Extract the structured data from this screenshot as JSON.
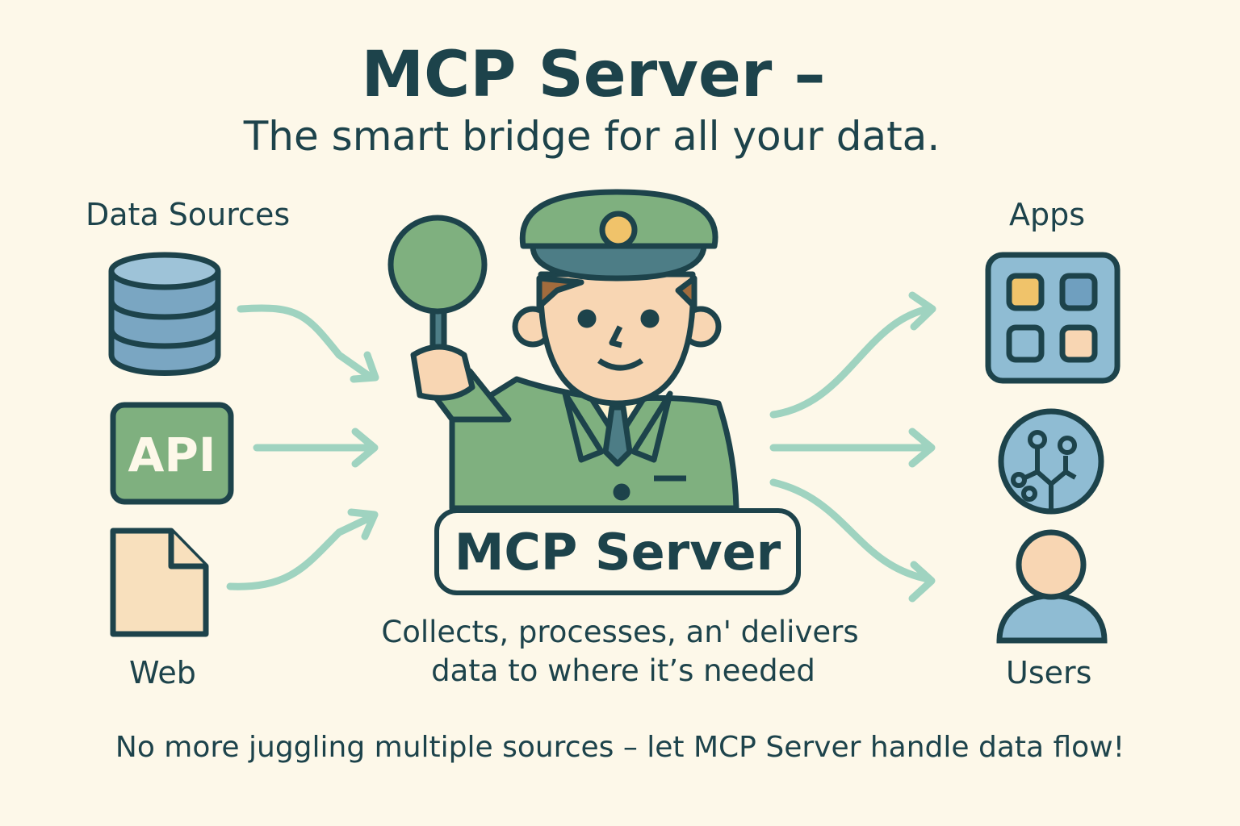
{
  "title": "MCP Server –",
  "subtitle": "The smart bridge for all your data.",
  "left": {
    "heading": "Data Sources",
    "items": [
      {
        "icon": "database-icon"
      },
      {
        "icon": "api-icon",
        "label": "API"
      },
      {
        "icon": "document-icon",
        "label": "Web"
      }
    ]
  },
  "right": {
    "heading": "Apps",
    "items": [
      {
        "icon": "apps-grid-icon"
      },
      {
        "icon": "circuit-icon"
      },
      {
        "icon": "user-icon",
        "label": "Users"
      }
    ]
  },
  "center": {
    "box_label": "MCP Server",
    "description_line1": "Collects, processes, an' delivers",
    "description_line2": "data to where it’s needed"
  },
  "footer": "No more juggling multiple sources – let MCP Server handle data flow!",
  "colors": {
    "background": "#fdf8e9",
    "ink": "#1d434b",
    "green": "#7fb07f",
    "blue": "#7aa6c2",
    "arrow": "#9fd3c0",
    "skin": "#f8d6b3",
    "gold": "#f0c36a"
  }
}
